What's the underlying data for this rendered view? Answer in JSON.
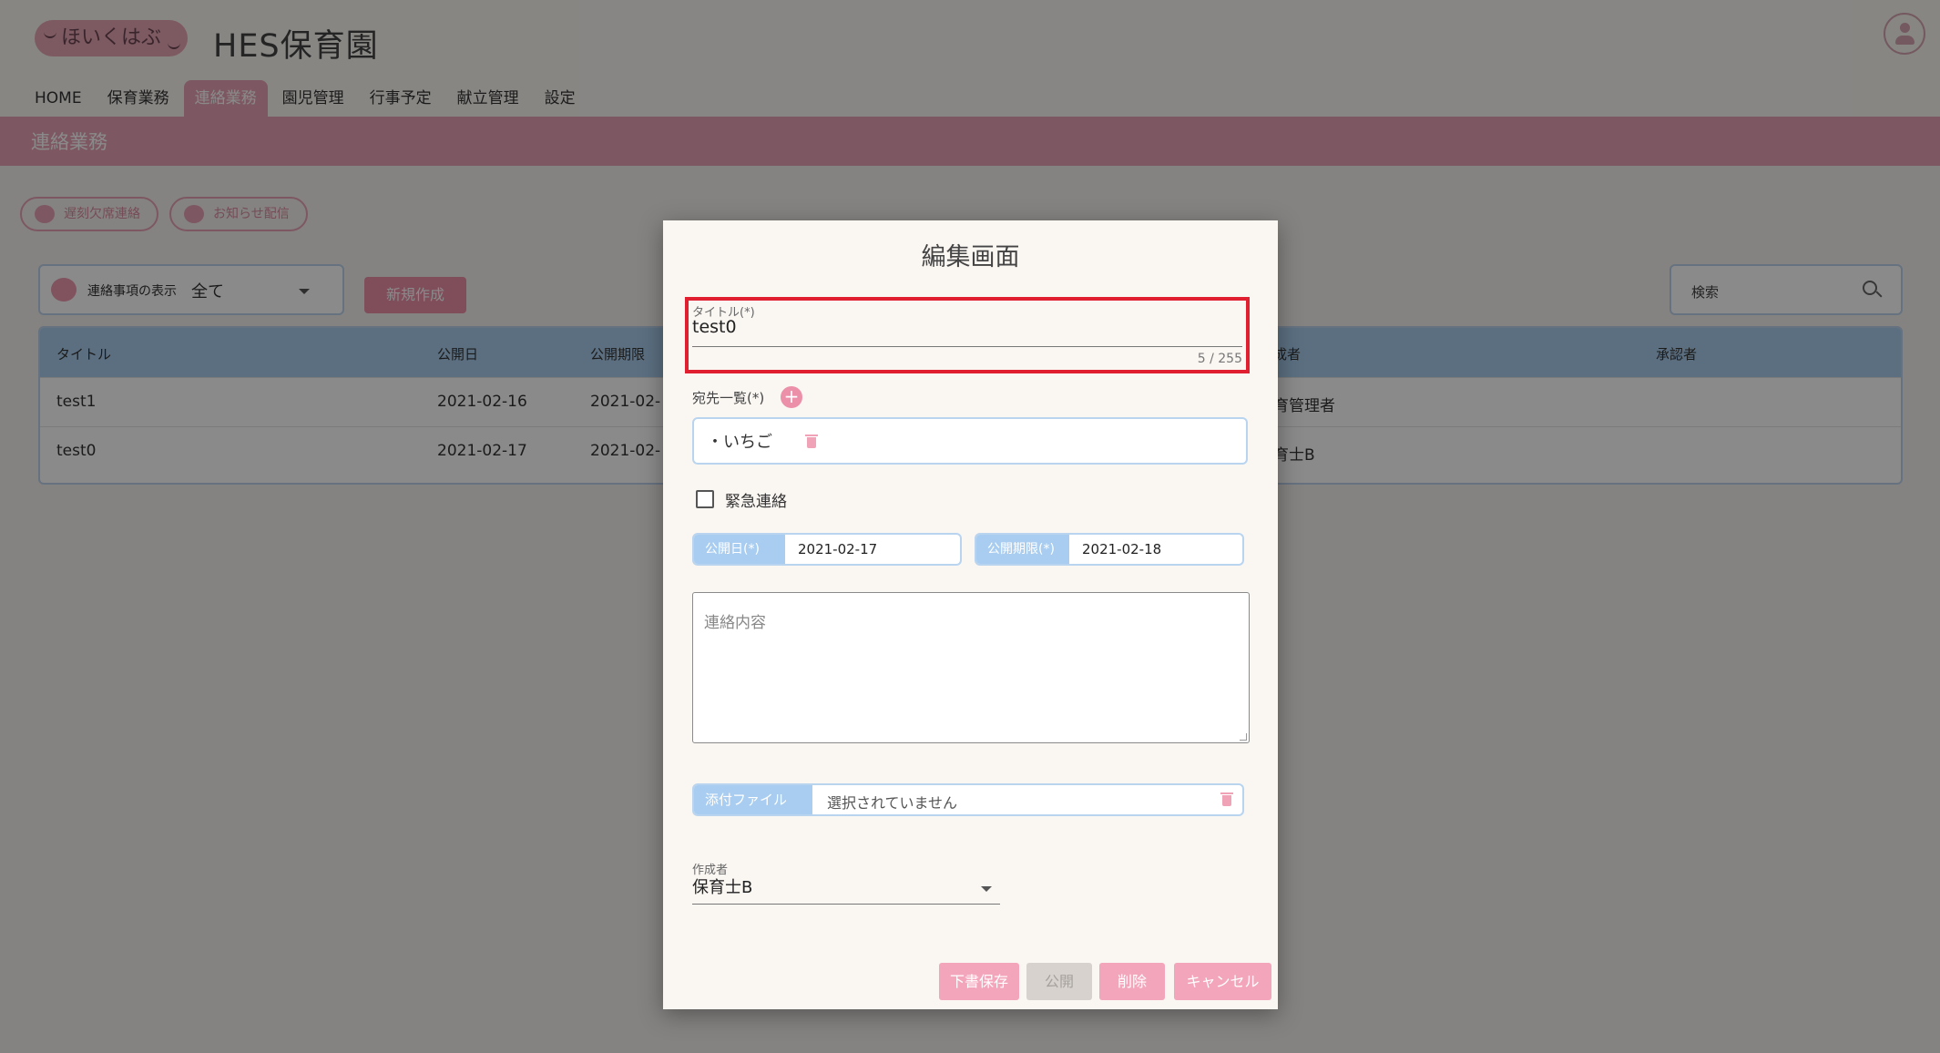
{
  "header": {
    "logo_text": "ほいくはぶ",
    "site_name": "HES保育園",
    "user_icon": "user-icon"
  },
  "nav": {
    "items": [
      "HOME",
      "保育業務",
      "連絡業務",
      "園児管理",
      "行事予定",
      "献立管理",
      "設定"
    ],
    "active": "連絡業務"
  },
  "banner": {
    "title": "連絡業務"
  },
  "actions": {
    "absence_label": "遅刻欠席連絡",
    "notice_label": "お知らせ配信"
  },
  "filter": {
    "label": "連絡事項の表示",
    "value": "全て",
    "new_button": "新規作成"
  },
  "search": {
    "label": "検索"
  },
  "table": {
    "headers": [
      "タイトル",
      "公開日",
      "公開期限",
      "作成者",
      "承認者"
    ],
    "rows": [
      {
        "title": "test1",
        "date": "2021-02-16",
        "limit": "2021-02-",
        "author": "保育管理者"
      },
      {
        "title": "test0",
        "date": "2021-02-17",
        "limit": "2021-02-",
        "author": "保育士B"
      }
    ],
    "partial_headers": {
      "author": "成者"
    },
    "partial_rows": [
      "育管理者",
      "育士B"
    ]
  },
  "modal": {
    "title": "編集画面",
    "title_field": {
      "label": "タイトル(*)",
      "value": "test0",
      "counter": "5 / 255"
    },
    "recipients": {
      "label": "宛先一覧(*)",
      "add": "+",
      "items": [
        "・いちご"
      ]
    },
    "urgent": {
      "label": "緊急連絡",
      "checked": false
    },
    "publish_date": {
      "label": "公開日(*)",
      "value": "2021-02-17"
    },
    "publish_limit": {
      "label": "公開期限(*)",
      "value": "2021-02-18"
    },
    "content": {
      "placeholder": "連絡内容"
    },
    "attachment": {
      "label": "添付ファイル",
      "value": "選択されていません"
    },
    "author": {
      "label": "作成者",
      "value": "保育士B"
    },
    "buttons": {
      "draft": "下書保存",
      "publish": "公開",
      "delete": "削除",
      "cancel": "キャンセル"
    }
  },
  "colors": {
    "accent_pink": "#e8a3b6",
    "accent_blue": "#a8cdf0",
    "highlight_red": "#e02030"
  }
}
